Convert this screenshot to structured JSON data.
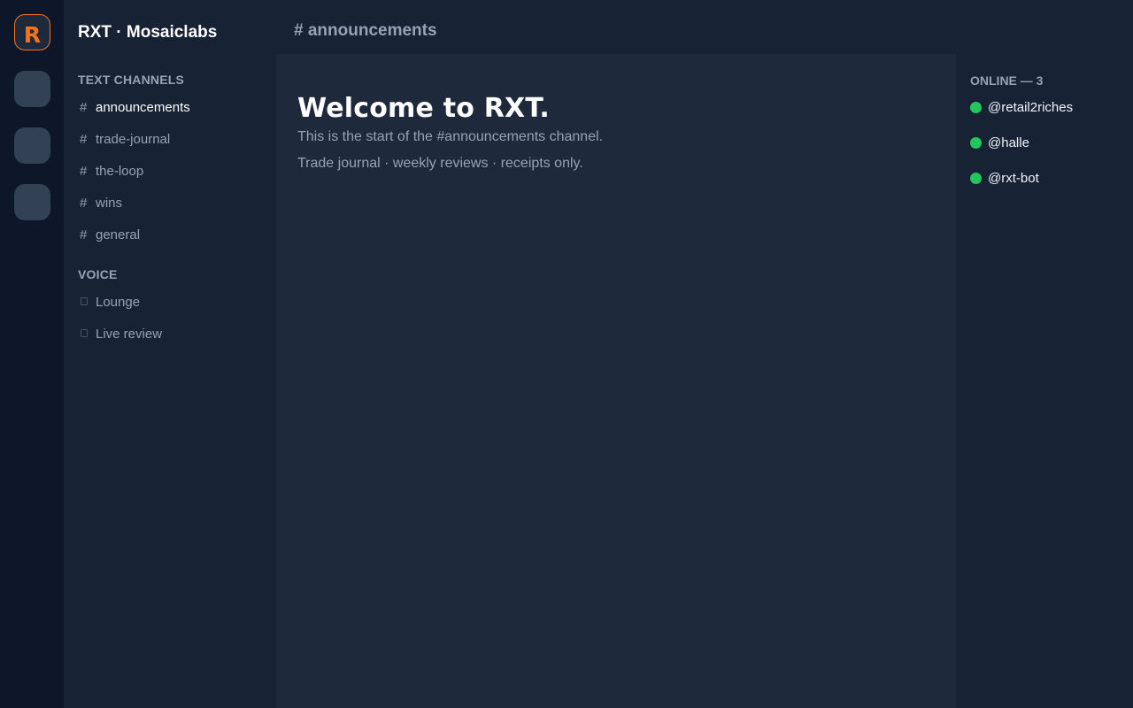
{
  "server_rail": {
    "logo_letter": "R",
    "colors": {
      "accent": "#f97316",
      "placeholder": "#334155"
    }
  },
  "sidebar": {
    "server_name": "RXT · Mosaiclabs",
    "text_section": "TEXT CHANNELS",
    "text_channels": [
      {
        "label": "announcements",
        "active": true
      },
      {
        "label": "trade-journal",
        "active": false
      },
      {
        "label": "the-loop",
        "active": false
      },
      {
        "label": "wins",
        "active": false
      },
      {
        "label": "general",
        "active": false
      }
    ],
    "voice_section": "VOICE",
    "voice_channels": [
      {
        "label": "Lounge"
      },
      {
        "label": "Live review"
      }
    ],
    "hash_glyph": "#"
  },
  "header": {
    "title": "# announcements"
  },
  "main": {
    "welcome_title": "Welcome to RXT.",
    "line_1": "This is the start of the #announcements channel.",
    "line_2": "Trade journal · weekly reviews · receipts only."
  },
  "members": {
    "online_label": "ONLINE — 3",
    "online_color": "#22c55e",
    "list": [
      {
        "handle": "@retail2riches"
      },
      {
        "handle": "@halle"
      },
      {
        "handle": "@rxt-bot"
      }
    ]
  }
}
